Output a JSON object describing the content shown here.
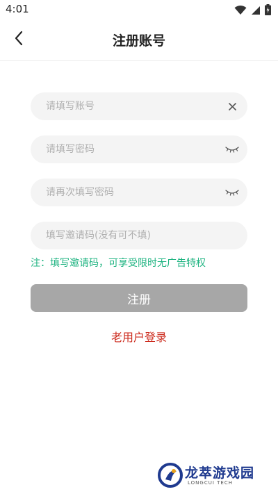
{
  "status_bar": {
    "time": "4:01",
    "icons": [
      "wifi-icon",
      "signal-icon",
      "battery-icon"
    ]
  },
  "app_bar": {
    "title": "注册账号",
    "back_icon": "chevron-left-icon"
  },
  "form": {
    "account": {
      "placeholder": "请填写账号",
      "value": "",
      "action_icon": "clear-icon"
    },
    "password": {
      "placeholder": "请填写密码",
      "value": "",
      "action_icon": "eye-closed-icon"
    },
    "password_confirm": {
      "placeholder": "请再次填写密码",
      "value": "",
      "action_icon": "eye-closed-icon"
    },
    "invite_code": {
      "placeholder": "填写邀请码(没有可不填)",
      "value": ""
    },
    "hint": "注：填写邀请码，可享受限时无广告特权",
    "hint_color": "#1db380"
  },
  "actions": {
    "register_label": "注册",
    "register_color": "#a7a7a7",
    "old_user_label": "老用户登录",
    "old_user_color": "#cc2a1c"
  },
  "watermark": {
    "text": "龙萃游戏园",
    "sub": "LONGCUI TECH"
  }
}
